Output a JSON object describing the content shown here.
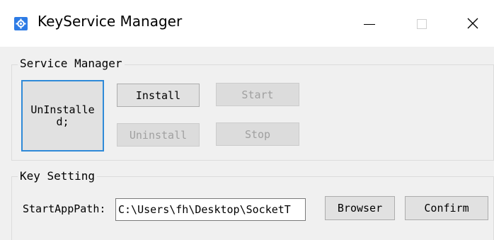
{
  "window": {
    "title": "KeyService Manager",
    "icon": "gear-icon",
    "controls": [
      "minimize",
      "maximize",
      "close"
    ]
  },
  "service_manager": {
    "group_title": "Service Manager",
    "status_text": "UnInstalled;",
    "install_label": "Install",
    "start_label": "Start",
    "uninstall_label": "Uninstall",
    "stop_label": "Stop"
  },
  "key_setting": {
    "group_title": "Key Setting",
    "path_label": "StartAppPath:",
    "path_value": "C:\\Users\\fh\\Desktop\\SocketT",
    "browser_label": "Browser",
    "confirm_label": "Confirm"
  },
  "colors": {
    "accent": "#2f8ad8",
    "window_bg": "#f0f0f0",
    "disabled_text": "#a0a0a0"
  }
}
